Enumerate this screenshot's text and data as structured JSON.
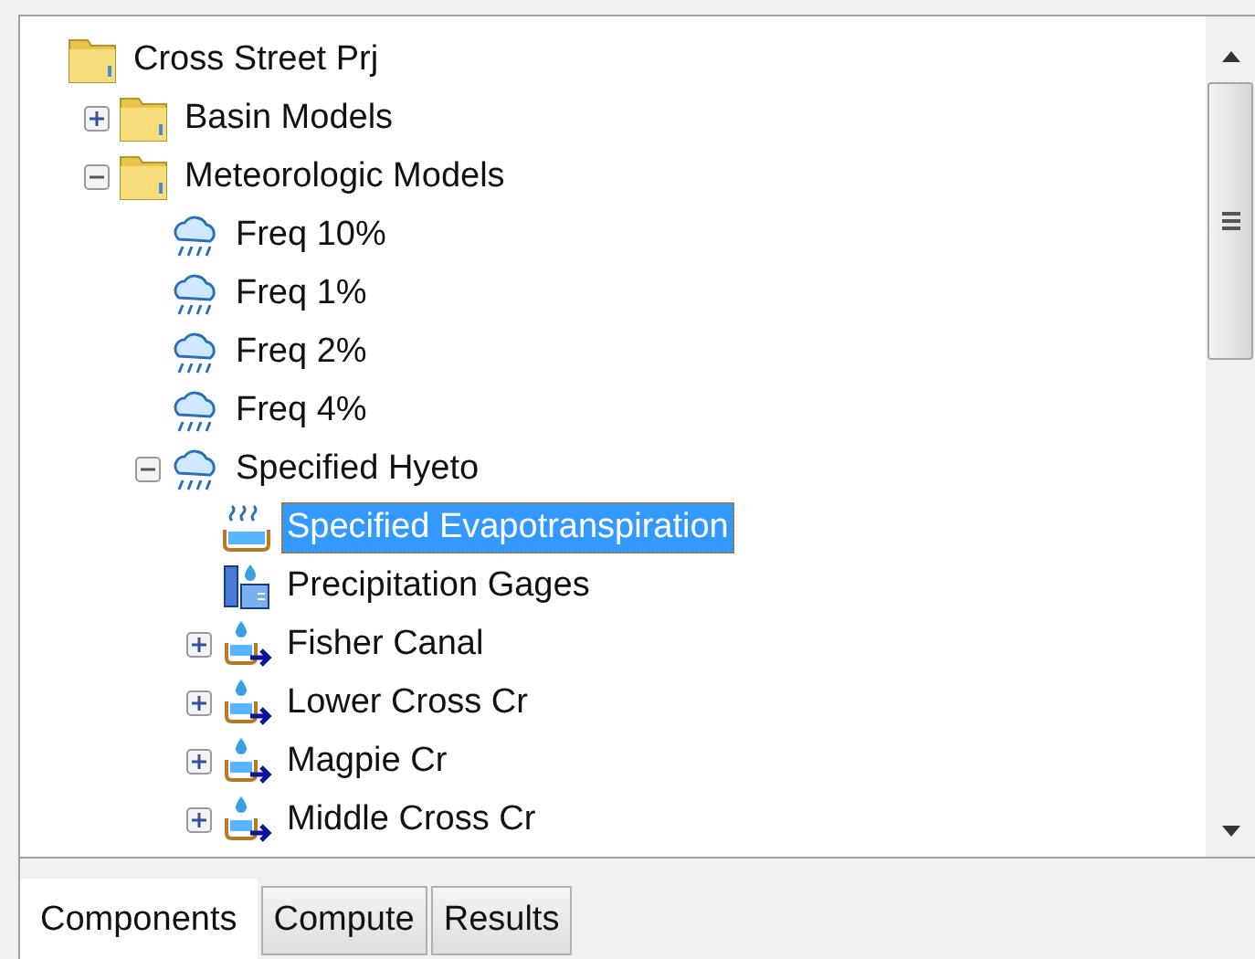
{
  "tree": [
    {
      "label": "Cross Street Prj",
      "kind": "folder",
      "selected": false,
      "children": [
        {
          "label": "Basin Models",
          "kind": "folder",
          "expanded": false,
          "selected": false
        },
        {
          "label": "Meteorologic Models",
          "kind": "folder",
          "expanded": true,
          "selected": false,
          "children": [
            {
              "label": "Freq 10%",
              "kind": "weather",
              "selected": false
            },
            {
              "label": "Freq 1%",
              "kind": "weather",
              "selected": false
            },
            {
              "label": "Freq 2%",
              "kind": "weather",
              "selected": false
            },
            {
              "label": "Freq 4%",
              "kind": "weather",
              "selected": false
            },
            {
              "label": "Specified Hyeto",
              "kind": "weather",
              "expanded": true,
              "selected": false,
              "children": [
                {
                  "label": "Specified Evapotranspiration",
                  "kind": "evaporation",
                  "selected": true
                },
                {
                  "label": "Precipitation Gages",
                  "kind": "gage",
                  "selected": false
                },
                {
                  "label": "Fisher Canal",
                  "kind": "subbasin",
                  "expanded": false,
                  "selected": false
                },
                {
                  "label": "Lower Cross Cr",
                  "kind": "subbasin",
                  "expanded": false,
                  "selected": false
                },
                {
                  "label": "Magpie Cr",
                  "kind": "subbasin",
                  "expanded": false,
                  "selected": false
                },
                {
                  "label": "Middle Cross Cr",
                  "kind": "subbasin",
                  "expanded": false,
                  "selected": false
                }
              ]
            }
          ]
        }
      ]
    }
  ],
  "tabs": [
    {
      "label": "Components",
      "selected": true
    },
    {
      "label": "Compute",
      "selected": false
    },
    {
      "label": "Results",
      "selected": false
    }
  ]
}
